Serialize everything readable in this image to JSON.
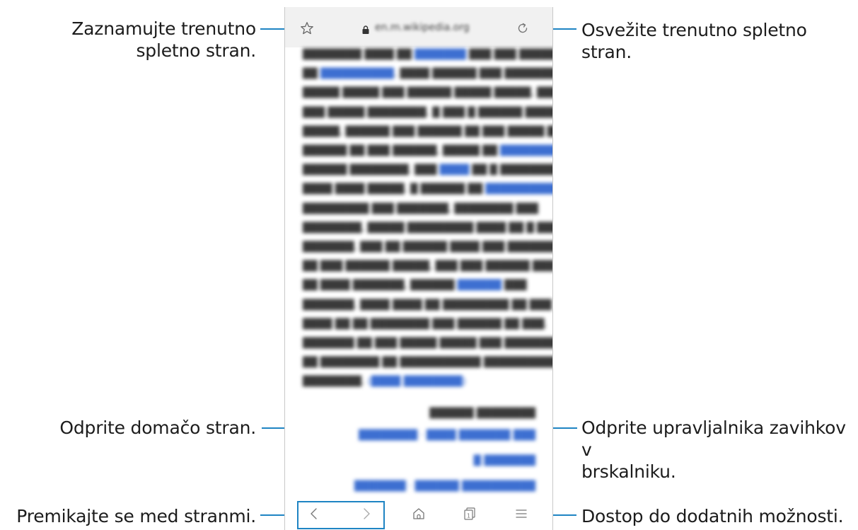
{
  "callouts": {
    "bookmark": "Zaznamujte trenutno spletno stran.",
    "refresh": "Osvežite trenutno spletno stran.",
    "home": "Odprite domačo stran.",
    "tabs_line1": "Odprite upravljalnika zavihkov v",
    "tabs_line2": "brskalniku.",
    "navigate": "Premikajte se med stranmi.",
    "more": "Dostop do dodatnih možnosti."
  },
  "browser": {
    "url": "en.m.wikipedia.org",
    "tab_count": "1",
    "icons": [
      "star-icon",
      "lock-icon",
      "reload-icon",
      "back-icon",
      "forward-icon",
      "home-icon",
      "tabs-icon",
      "menu-icon"
    ]
  },
  "colors": {
    "callout_line": "#1e84c3",
    "urlbar_bg": "#f1f1f1",
    "link": "#3d6fd1"
  }
}
